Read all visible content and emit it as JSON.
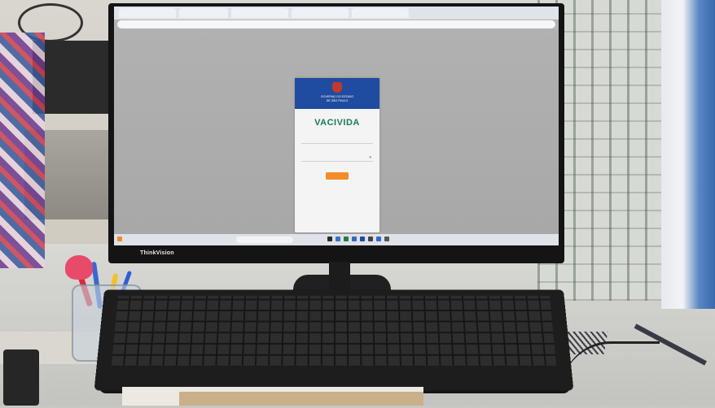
{
  "browser": {
    "tabs": [
      "",
      "",
      "",
      "",
      ""
    ],
    "address": ""
  },
  "login_card": {
    "header_line1": "GOVERNO DO ESTADO",
    "header_line2": "DE SÃO PAULO",
    "app_title": "VACIVIDA",
    "user_placeholder": "",
    "profile_placeholder": "",
    "button_label": "",
    "link1": "",
    "link2": "",
    "footer": ""
  },
  "taskbar": {
    "search_placeholder": "",
    "clock": ""
  },
  "monitor_brand": "ThinkVision"
}
